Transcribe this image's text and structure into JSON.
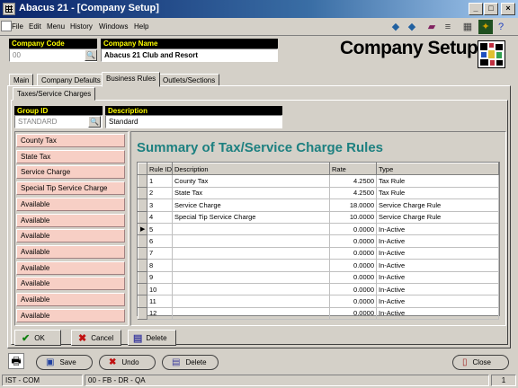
{
  "window": {
    "title": "Abacus 21 - [Company Setup]",
    "controls": [
      "_",
      "□",
      "×"
    ]
  },
  "menu": [
    "File",
    "Edit",
    "Menu",
    "History",
    "Windows",
    "Help"
  ],
  "toolbar": {
    "icons": [
      "back-arrow-icon",
      "forward-arrow-icon",
      "book-icon",
      "list-icon",
      "calculator-icon",
      "run-icon",
      "help-icon"
    ],
    "inner_controls": [
      "_",
      "□",
      "×"
    ]
  },
  "company": {
    "code_label": "Company Code",
    "code_value": "00",
    "name_label": "Company Name",
    "name_value": "Abacus 21 Club and Resort"
  },
  "page_title": "Company Setup",
  "tabs": [
    "Main",
    "Company Defaults",
    "Business Rules",
    "Outlets/Sections"
  ],
  "active_tab": "Business Rules",
  "subtabs": [
    "Taxes/Service Charges"
  ],
  "group": {
    "id_label": "Group ID",
    "id_value": "STANDARD",
    "desc_label": "Description",
    "desc_value": "Standard"
  },
  "rule_buttons": [
    "County Tax",
    "State Tax",
    "Service Charge",
    "Special Tip Service Charge",
    "Available",
    "Available",
    "Available",
    "Available",
    "Available",
    "Available",
    "Available",
    "Available"
  ],
  "summary_title": "Summary of Tax/Service Charge Rules",
  "table": {
    "columns": [
      "Rule ID",
      "Description",
      "Rate",
      "Type"
    ],
    "rows": [
      {
        "id": "1",
        "desc": "County Tax",
        "rate": "4.2500",
        "type": "Tax Rule"
      },
      {
        "id": "2",
        "desc": "State Tax",
        "rate": "4.2500",
        "type": "Tax Rule"
      },
      {
        "id": "3",
        "desc": "Service Charge",
        "rate": "18.0000",
        "type": "Service Charge Rule"
      },
      {
        "id": "4",
        "desc": "Special Tip Service Charge",
        "rate": "10.0000",
        "type": "Service Charge Rule"
      },
      {
        "id": "5",
        "desc": "",
        "rate": "0.0000",
        "type": "In-Active"
      },
      {
        "id": "6",
        "desc": "",
        "rate": "0.0000",
        "type": "In-Active"
      },
      {
        "id": "7",
        "desc": "",
        "rate": "0.0000",
        "type": "In-Active"
      },
      {
        "id": "8",
        "desc": "",
        "rate": "0.0000",
        "type": "In-Active"
      },
      {
        "id": "9",
        "desc": "",
        "rate": "0.0000",
        "type": "In-Active"
      },
      {
        "id": "10",
        "desc": "",
        "rate": "0.0000",
        "type": "In-Active"
      },
      {
        "id": "11",
        "desc": "",
        "rate": "0.0000",
        "type": "In-Active"
      },
      {
        "id": "12",
        "desc": "",
        "rate": "0.0000",
        "type": "In-Active"
      }
    ],
    "selected_index": 4
  },
  "panel_buttons": {
    "ok": "OK",
    "cancel": "Cancel",
    "delete": "Delete"
  },
  "bottom_buttons": {
    "save": "Save",
    "undo": "Undo",
    "delete": "Delete",
    "close": "Close"
  },
  "status": {
    "user": "IST - COM",
    "path": "00 - FB - DR - QA",
    "page": "1"
  },
  "colors": {
    "title_bar": "#0a246a",
    "rule_button_bg": "#f7cfc5",
    "summary_title": "#1d8080",
    "label_bg": "#000000",
    "label_text": "#ffff00"
  }
}
